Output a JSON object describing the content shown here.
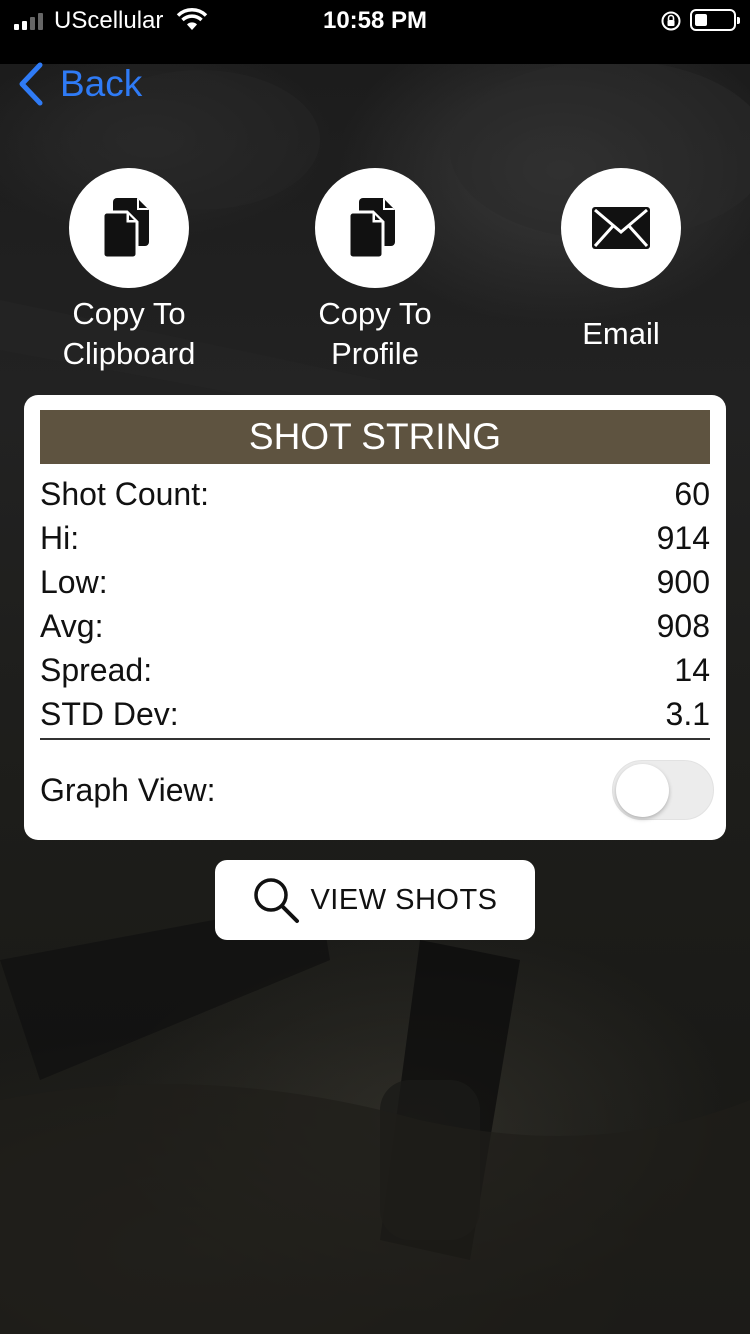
{
  "status_bar": {
    "carrier": "UScellular",
    "time": "10:58 PM",
    "signal_icon": "signal-bars-icon",
    "wifi_icon": "wifi-icon",
    "rotation_lock_icon": "rotation-lock-icon",
    "battery_icon": "battery-icon"
  },
  "nav": {
    "back_label": "Back",
    "accent_color": "#2f7bf6"
  },
  "actions": [
    {
      "icon": "documents-icon",
      "line1": "Copy To",
      "line2": "Clipboard"
    },
    {
      "icon": "documents-icon",
      "line1": "Copy To",
      "line2": "Profile"
    },
    {
      "icon": "envelope-icon",
      "line1": "Email",
      "line2": ""
    }
  ],
  "card": {
    "header": "SHOT STRING",
    "header_color": "#5e5340",
    "stats": [
      {
        "label": "Shot Count:",
        "value": "60"
      },
      {
        "label": "Hi:",
        "value": "914"
      },
      {
        "label": "Low:",
        "value": "900"
      },
      {
        "label": "Avg:",
        "value": "908"
      },
      {
        "label": "Spread:",
        "value": "14"
      },
      {
        "label": "STD Dev:",
        "value": "3.1"
      }
    ],
    "graph_view_label": "Graph View:",
    "graph_view_on": false
  },
  "view_shots": {
    "label": "VIEW SHOTS",
    "icon": "magnifier-icon"
  }
}
